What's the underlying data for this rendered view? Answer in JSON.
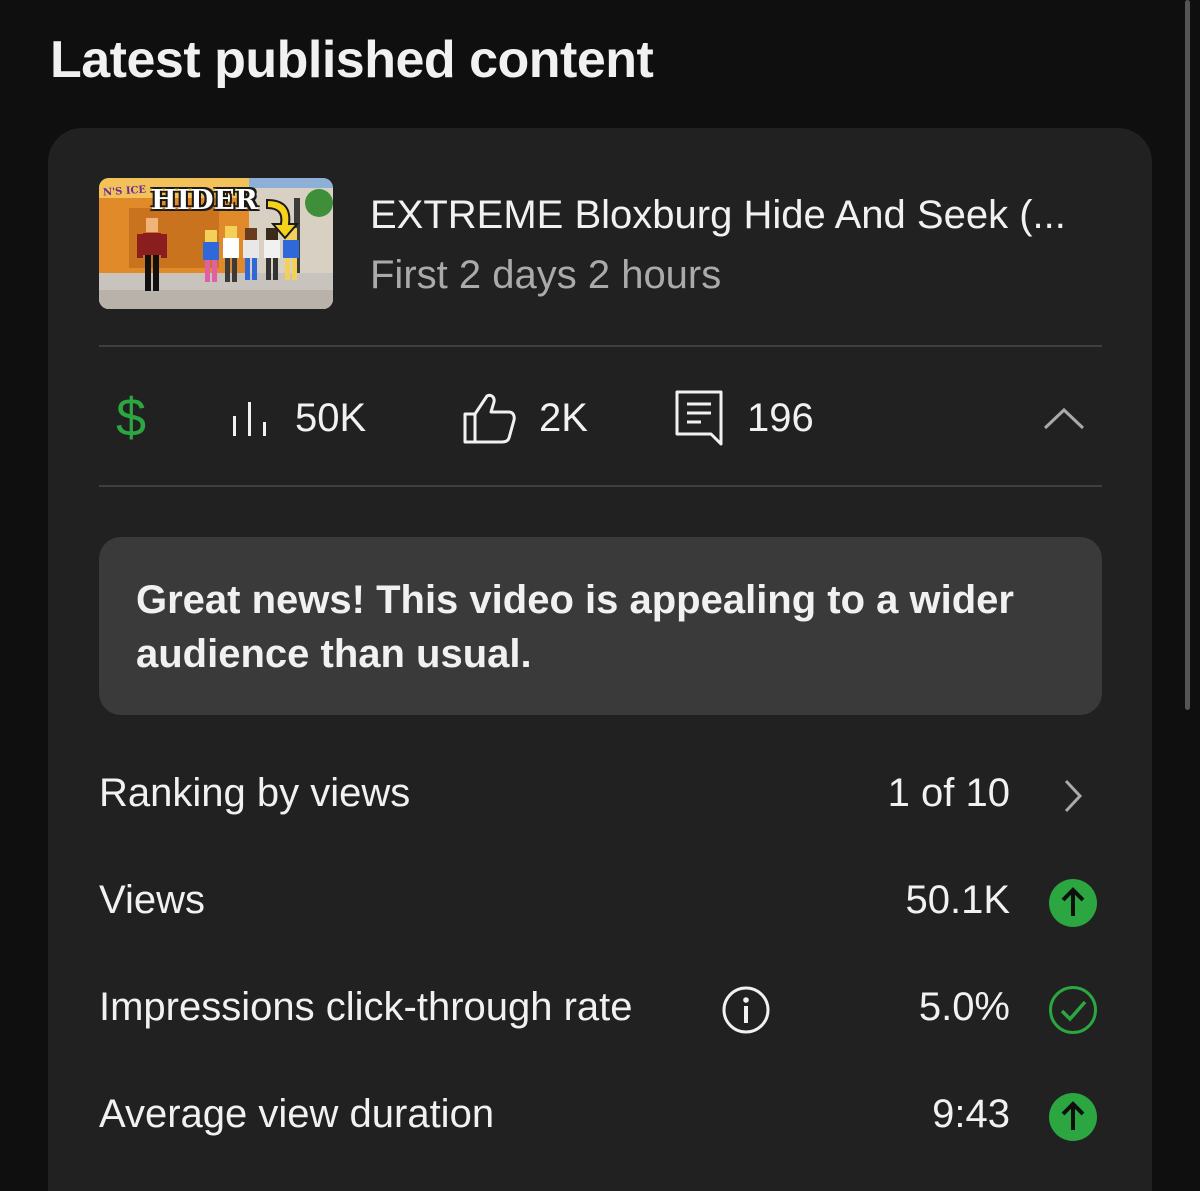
{
  "section": {
    "title": "Latest published content"
  },
  "video": {
    "title": "EXTREME Bloxburg Hide And Seek (...",
    "subtitle": "First 2 days 2 hours",
    "thumbnail_text": "HIDER",
    "thumbnail_sign": "N'S ICE"
  },
  "stats": {
    "views": "50K",
    "likes": "2K",
    "comments": "196",
    "monetization_symbol": "$"
  },
  "banner": {
    "text": "Great news! This video is appealing to a wider audience than usual."
  },
  "metrics": [
    {
      "label": "Ranking by views",
      "value": "1 of 10",
      "indicator": "chevron-right-icon"
    },
    {
      "label": "Views",
      "value": "50.1K",
      "indicator": "arrow-up-circle-icon"
    },
    {
      "label": "Impressions click-through rate",
      "value": "5.0%",
      "indicator": "check-circle-icon"
    },
    {
      "label": "Average view duration",
      "value": "9:43",
      "indicator": "arrow-up-circle-icon"
    }
  ],
  "colors": {
    "background": "#0f0f0f",
    "card": "#212121",
    "banner": "#3a3a3a",
    "accent_green": "#2ba640",
    "secondary_text": "#aaaaaa"
  }
}
